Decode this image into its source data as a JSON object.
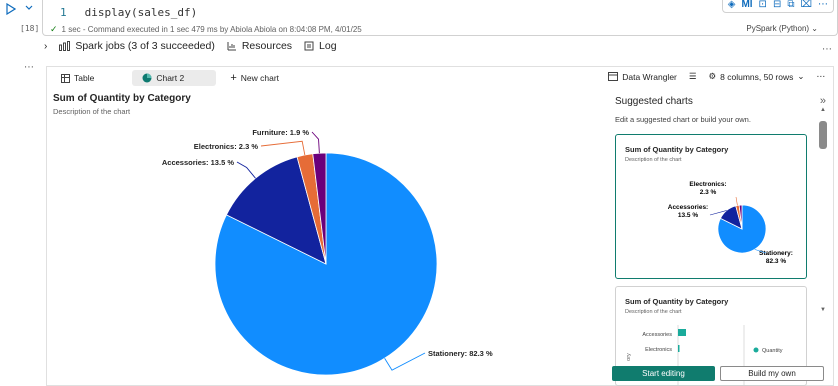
{
  "cell": {
    "line_number": "1",
    "code": "display(sales_df)",
    "exec_count": "[18]",
    "status": "1 sec - Command executed in 1 sec 479 ms by Abiola Abiola on 8:04:08 PM, 4/01/25",
    "language": "PySpark (Python)",
    "toolbar_md": "Ml"
  },
  "spark": {
    "jobs_label": "Spark jobs (3 of 3 succeeded)",
    "resources_label": "Resources",
    "log_label": "Log"
  },
  "tabs": {
    "table": "Table",
    "chart2": "Chart 2",
    "new_chart": "New chart",
    "data_wrangler": "Data Wrangler",
    "columns_rows": "8 columns, 50 rows"
  },
  "chart": {
    "title": "Sum of Quantity by Category",
    "description": "Description of the chart"
  },
  "chart_data": {
    "type": "pie",
    "title": "Sum of Quantity by Category",
    "categories": [
      "Stationery",
      "Accessories",
      "Electronics",
      "Furniture"
    ],
    "values": [
      82.3,
      13.5,
      2.3,
      1.9
    ],
    "labels": [
      "Stationery: 82.3 %",
      "Accessories: 13.5 %",
      "Electronics: 2.3 %",
      "Furniture: 1.9 %"
    ],
    "colors": [
      "#118dff",
      "#12239e",
      "#e66c37",
      "#6b007b"
    ]
  },
  "suggested": {
    "title": "Suggested charts",
    "subtitle": "Edit a suggested chart or build your own.",
    "card1": {
      "title": "Sum of Quantity by Category",
      "description": "Description of the chart",
      "labels": {
        "electronics": [
          "Electronics:",
          "2.3 %"
        ],
        "accessories": [
          "Accessories:",
          "13.5 %"
        ],
        "stationery": [
          "Stationery:",
          "82.3 %"
        ]
      }
    },
    "card2": {
      "title": "Sum of Quantity by Category",
      "description": "Description of the chart",
      "cat1": "Accessories",
      "cat2": "Electronics",
      "legend": "Quantity",
      "axis": "ory"
    },
    "start_editing": "Start editing",
    "build_my_own": "Build my own"
  }
}
